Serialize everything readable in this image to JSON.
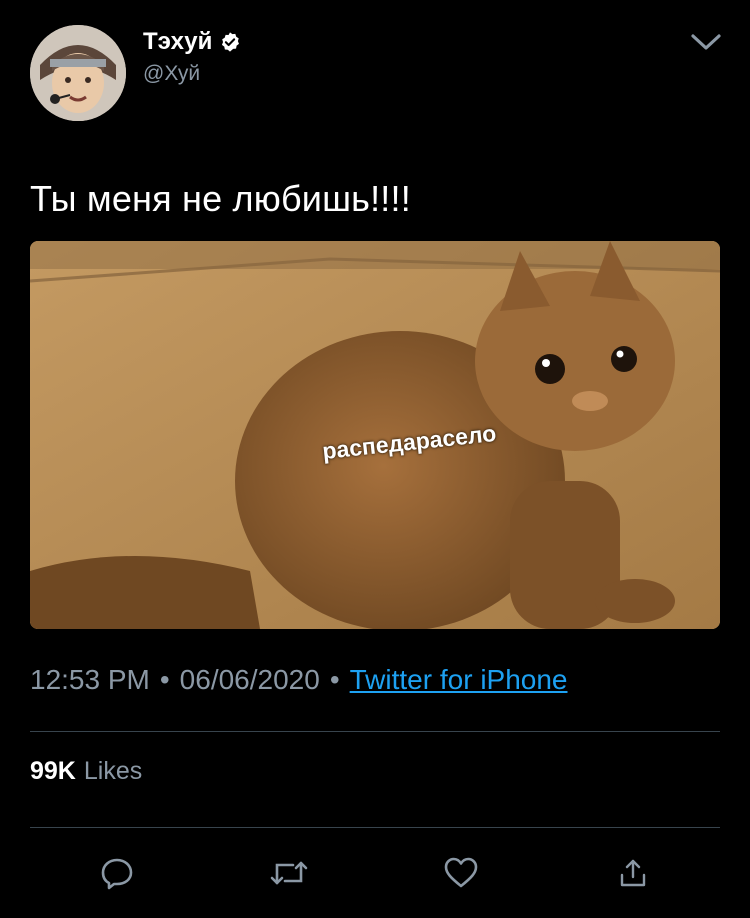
{
  "tweet": {
    "author_name": "Тэхуй",
    "author_handle": "@Хуй",
    "text": "Ты меня не любишь!!!!",
    "image_caption": "распедарасело",
    "time": "12:53 PM",
    "date": "06/06/2020",
    "source": "Twitter for iPhone",
    "separator": "•",
    "likes_count": "99K",
    "likes_label": "Likes"
  },
  "icons": {
    "verified": "verified-badge-icon",
    "more": "chevron-down-icon",
    "reply": "reply-icon",
    "retweet": "retweet-icon",
    "like": "heart-icon",
    "share": "share-icon"
  },
  "colors": {
    "background": "#000000",
    "secondary_text": "#8b98a5",
    "link": "#1da1f2",
    "divider": "#38444d"
  }
}
